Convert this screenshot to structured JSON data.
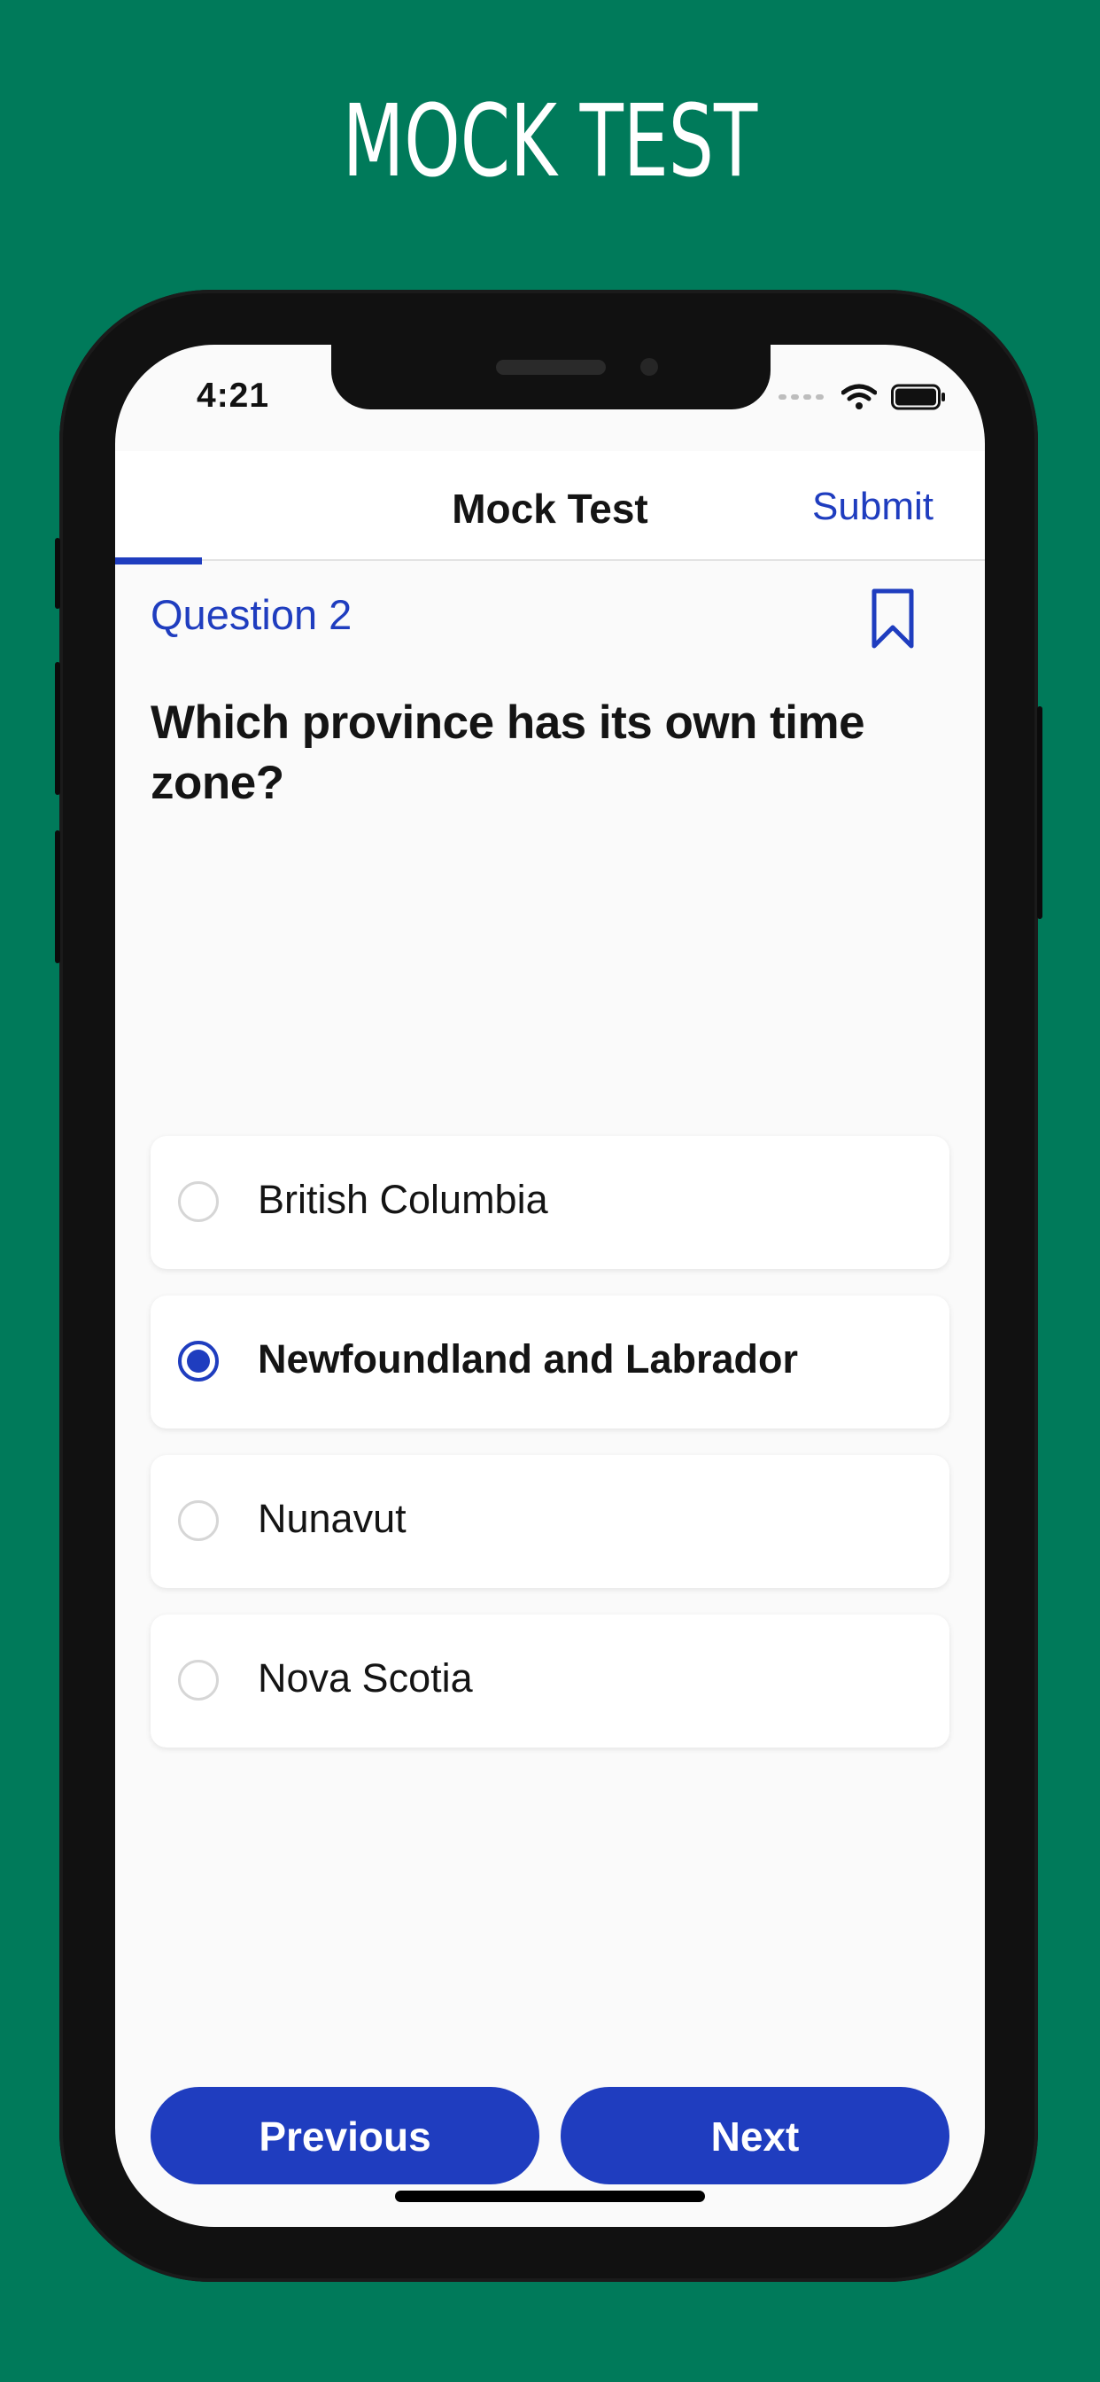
{
  "promo": {
    "title": "MOCK TEST"
  },
  "status_bar": {
    "time": "4:21"
  },
  "nav": {
    "title": "Mock Test",
    "submit_label": "Submit"
  },
  "progress": {
    "fraction": 0.1
  },
  "question": {
    "label": "Question 2",
    "text": "Which province has its own time zone?"
  },
  "options": [
    {
      "label": "British Columbia",
      "selected": false
    },
    {
      "label": "Newfoundland and Labrador",
      "selected": true
    },
    {
      "label": "Nunavut",
      "selected": false
    },
    {
      "label": "Nova Scotia",
      "selected": false
    }
  ],
  "footer": {
    "previous_label": "Previous",
    "next_label": "Next"
  },
  "colors": {
    "background": "#007A5A",
    "accent": "#1F3DBF",
    "screen": "#FAFAFA"
  },
  "icons": {
    "bookmark": "bookmark-icon",
    "wifi": "wifi-icon",
    "battery": "battery-icon",
    "signal": "signal-icon"
  }
}
